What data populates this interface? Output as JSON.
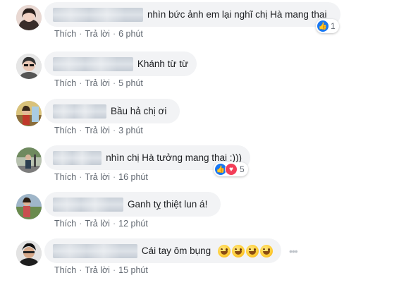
{
  "comments": [
    {
      "avatar": "avatar-woman-icon",
      "text": "nhìn bức ảnh em lại nghĩ chị Hà mang thai",
      "actions": {
        "like": "Thích",
        "reply": "Trả lời",
        "time": "6 phút"
      },
      "reaction": {
        "icons": [
          "like-icon"
        ],
        "count": "1"
      }
    },
    {
      "avatar": "avatar-glasses-icon",
      "text": "Khánh từ từ",
      "actions": {
        "like": "Thích",
        "reply": "Trả lời",
        "time": "5 phút"
      }
    },
    {
      "avatar": "avatar-outdoor-icon",
      "text": "Bầu hả chị ơi",
      "actions": {
        "like": "Thích",
        "reply": "Trả lời",
        "time": "3 phút"
      }
    },
    {
      "avatar": "avatar-street-icon",
      "text": "nhìn chị Hà tưởng mang thai :)))",
      "actions": {
        "like": "Thích",
        "reply": "Trả lời",
        "time": "16 phút"
      },
      "reaction": {
        "icons": [
          "like-icon",
          "love-icon"
        ],
        "count": "5"
      }
    },
    {
      "avatar": "avatar-scenery-icon",
      "text": "Ganh tỵ thiệt lun á!",
      "actions": {
        "like": "Thích",
        "reply": "Trả lời",
        "time": "12 phút"
      }
    },
    {
      "avatar": "avatar-man-icon",
      "text": "Cái tay ôm bụng",
      "emojis": [
        "grinning-sweat-emoji",
        "grinning-sweat-emoji",
        "grinning-sweat-emoji",
        "grinning-sweat-emoji"
      ],
      "actions": {
        "like": "Thích",
        "reply": "Trả lời",
        "time": "15 phút"
      },
      "more_icon": "more-options-icon"
    }
  ],
  "colors": {
    "bubble": "#f2f3f5",
    "text": "#1c1e21",
    "meta": "#606770",
    "like": "#1877f2",
    "love": "#f33e58"
  }
}
